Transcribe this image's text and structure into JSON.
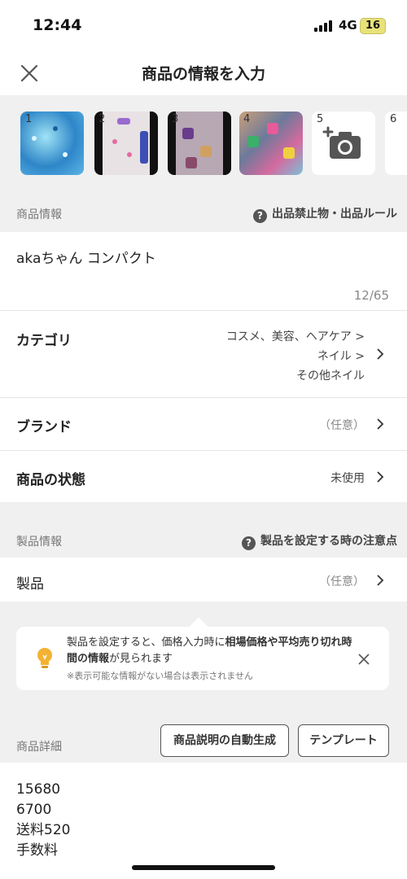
{
  "status_bar": {
    "time": "12:44",
    "network": "4G",
    "battery": "16"
  },
  "header": {
    "title": "商品の情報を入力",
    "close_icon": "close-icon"
  },
  "photos": {
    "numbers": [
      "1",
      "2",
      "3",
      "4",
      "5",
      "6"
    ],
    "add_icon": "camera-plus-icon"
  },
  "product_info": {
    "section_label": "商品情報",
    "help_link": "出品禁止物・出品ルール",
    "title_value": "akaちゃん コンパクト",
    "char_count": "12/65",
    "category": {
      "label": "カテゴリ",
      "line1": "コスメ、美容、ヘアケア >",
      "line2": "ネイル >",
      "line3": "その他ネイル"
    },
    "brand": {
      "label": "ブランド",
      "value": "（任意）"
    },
    "condition": {
      "label": "商品の状態",
      "value": "未使用"
    }
  },
  "product_spec": {
    "section_label": "製品情報",
    "help_link": "製品を設定する時の注意点",
    "product": {
      "label": "製品",
      "value": "（任意）"
    }
  },
  "banner": {
    "text_before": "製品を設定すると、価格入力時に",
    "text_bold": "相場価格や平均売り切れ時間の情報",
    "text_after": "が見られます",
    "note": "※表示可能な情報がない場合は表示されません",
    "icon": "lightbulb-icon"
  },
  "details": {
    "section_label": "商品詳細",
    "auto_generate_button": "商品説明の自動生成",
    "template_button": "テンプレート",
    "description": "15680\n6700\n送料520\n手数料"
  }
}
